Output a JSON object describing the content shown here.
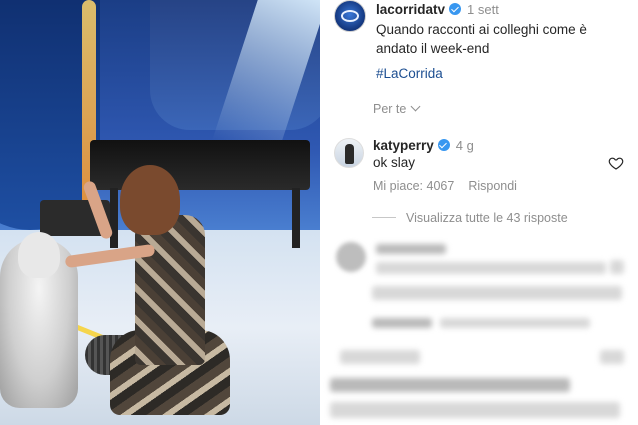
{
  "post": {
    "author": "lacorridatv",
    "time_ago": "1 sett",
    "caption": "Quando racconti ai colleghi come è andato il week-end",
    "hashtag": "#LaCorrida",
    "translate_label": "Per te"
  },
  "comment": {
    "author": "katyperry",
    "time_ago": "4 g",
    "text": "ok slay",
    "likes_label": "Mi piace: 4067",
    "reply_label": "Rispondi",
    "view_replies_label": "Visualizza tutte le 43 risposte"
  },
  "colors": {
    "verified": "#3897f0",
    "hashtag": "#1c4e91",
    "muted": "#8e8e8e",
    "text": "#262626"
  },
  "icons": [
    "verified-badge-icon",
    "chevron-down-icon",
    "heart-icon"
  ]
}
